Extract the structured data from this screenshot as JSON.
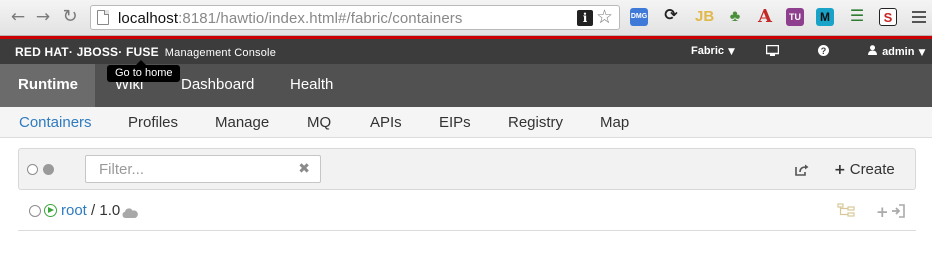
{
  "browser": {
    "url_host": "localhost",
    "url_rest": ":8181/hawtio/index.html#/fabric/containers",
    "extensions": [
      {
        "icon": "dmg-extension-icon",
        "label": "DMG",
        "color": "#3f7ad9"
      },
      {
        "icon": "sync-extension-icon",
        "label": "",
        "color": "#222222"
      },
      {
        "icon": "jb-extension-icon",
        "label": "JB",
        "color": "#e5c45a"
      },
      {
        "icon": "leaf-extension-icon",
        "label": "",
        "color": "#4a8f3a"
      },
      {
        "icon": "a-extension-icon",
        "label": "A",
        "color": "#c62828"
      },
      {
        "icon": "tu-extension-icon",
        "label": "TU",
        "color": "#8e3f8e"
      },
      {
        "icon": "m-extension-icon",
        "label": "M",
        "color": "#1aa3c8"
      },
      {
        "icon": "clip-extension-icon",
        "label": "",
        "color": "#2e7d32"
      },
      {
        "icon": "s-extension-icon",
        "label": "S",
        "color": "#c62828"
      }
    ]
  },
  "header": {
    "brand": "RED HAT· JBOSS· FUSE",
    "subtitle": "Management Console",
    "fabric": "Fabric",
    "user": "admin"
  },
  "tooltip": "Go to home",
  "topnav": [
    "Runtime",
    "Wiki",
    "Dashboard",
    "Health"
  ],
  "subnav": [
    "Containers",
    "Profiles",
    "Manage",
    "MQ",
    "APIs",
    "EIPs",
    "Registry",
    "Map"
  ],
  "toolbar": {
    "filter_placeholder": "Filter...",
    "create_label": "Create"
  },
  "containers": [
    {
      "name": "root",
      "version": "/ 1.0"
    }
  ]
}
